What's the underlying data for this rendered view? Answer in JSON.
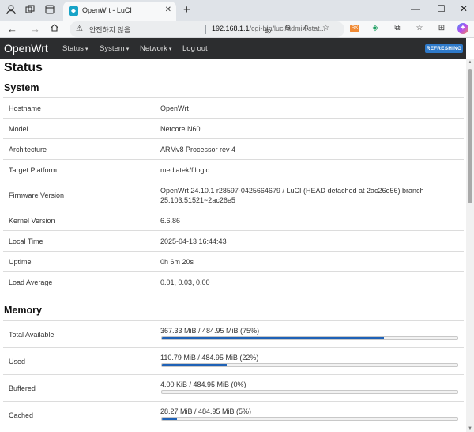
{
  "browser": {
    "tab_title": "OpenWrt - LuCI",
    "security_text": "안전하지 않음",
    "url_host": "192.168.1.1",
    "url_path": "/cgi-bin/luci/admin/stat...",
    "extension_badge": "RX"
  },
  "header": {
    "brand": "OpenWrt",
    "menu": [
      "Status",
      "System",
      "Network",
      "Log out"
    ],
    "refresh_badge": "REFRESHING"
  },
  "page": {
    "title": "Status",
    "system_title": "System",
    "system_rows": [
      {
        "label": "Hostname",
        "value": "OpenWrt"
      },
      {
        "label": "Model",
        "value": "Netcore N60"
      },
      {
        "label": "Architecture",
        "value": "ARMv8 Processor rev 4"
      },
      {
        "label": "Target Platform",
        "value": "mediatek/filogic"
      },
      {
        "label": "Firmware Version",
        "value": "OpenWrt 24.10.1 r28597-0425664679 / LuCI (HEAD detached at 2ac26e56) branch 25.103.51521~2ac26e5"
      },
      {
        "label": "Kernel Version",
        "value": "6.6.86"
      },
      {
        "label": "Local Time",
        "value": "2025-04-13 16:44:43"
      },
      {
        "label": "Uptime",
        "value": "0h 6m 20s"
      },
      {
        "label": "Load Average",
        "value": "0.01, 0.03, 0.00"
      }
    ],
    "memory_title": "Memory",
    "memory_rows": [
      {
        "label": "Total Available",
        "value": "367.33 MiB / 484.95 MiB (75%)",
        "percent": 75
      },
      {
        "label": "Used",
        "value": "110.79 MiB / 484.95 MiB (22%)",
        "percent": 22
      },
      {
        "label": "Buffered",
        "value": "4.00 KiB / 484.95 MiB (0%)",
        "percent": 0
      },
      {
        "label": "Cached",
        "value": "28.27 MiB / 484.95 MiB (5%)",
        "percent": 5
      }
    ]
  },
  "colors": {
    "header_bg": "#2c2d2f",
    "accent": "#1f62b7",
    "refresh_badge": "#2e79c9"
  }
}
